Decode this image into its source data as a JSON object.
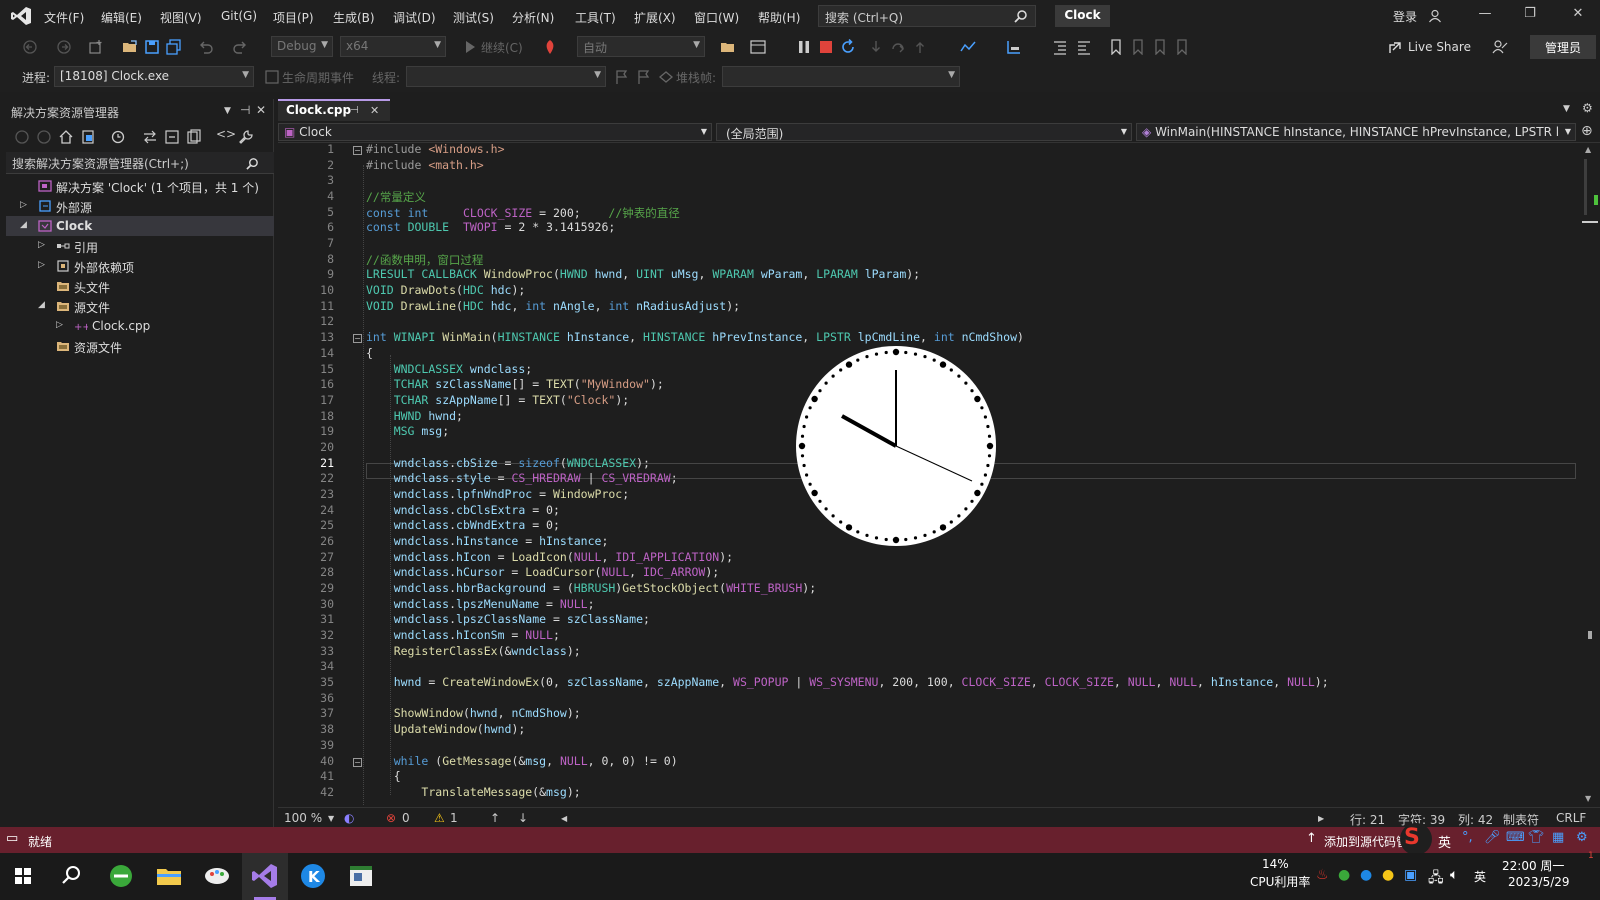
{
  "titlebar": {
    "menu": [
      "文件(F)",
      "编辑(E)",
      "视图(V)",
      "Git(G)",
      "项目(P)",
      "生成(B)",
      "调试(D)",
      "测试(S)",
      "分析(N)",
      "工具(T)",
      "扩展(X)",
      "窗口(W)",
      "帮助(H)"
    ],
    "search_placeholder": "搜索 (Ctrl+Q)",
    "solution_title": "Clock",
    "signin": "登录"
  },
  "toolbar": {
    "config": "Debug",
    "platform": "x64",
    "continue": "继续(C)",
    "auto": "自动",
    "live_share": "Live Share",
    "admin": "管理员",
    "process_label": "进程:",
    "process_value": "[18108] Clock.exe",
    "lifecycle": "生命周期事件",
    "thread_label": "线程:",
    "stackframe_label": "堆栈帧:"
  },
  "solution_explorer": {
    "title": "解决方案资源管理器",
    "search_placeholder": "搜索解决方案资源管理器(Ctrl+;)",
    "items": [
      {
        "label": "解决方案 'Clock' (1 个项目，共 1 个)",
        "level": 0,
        "twisty": "",
        "icon": "solution-icon"
      },
      {
        "label": "外部源",
        "level": 0,
        "twisty": "▷",
        "icon": "external-sources-icon"
      },
      {
        "label": "Clock",
        "level": 0,
        "twisty": "◢",
        "icon": "project-icon",
        "selected": true
      },
      {
        "label": "引用",
        "level": 1,
        "twisty": "▷",
        "icon": "references-icon"
      },
      {
        "label": "外部依赖项",
        "level": 1,
        "twisty": "▷",
        "icon": "dependencies-icon"
      },
      {
        "label": "头文件",
        "level": 1,
        "twisty": "",
        "icon": "filter-folder-icon"
      },
      {
        "label": "源文件",
        "level": 1,
        "twisty": "◢",
        "icon": "filter-folder-icon"
      },
      {
        "label": "Clock.cpp",
        "level": 2,
        "twisty": "▷",
        "icon": "cpp-file-icon"
      },
      {
        "label": "资源文件",
        "level": 1,
        "twisty": "",
        "icon": "filter-folder-icon"
      }
    ]
  },
  "editor": {
    "tab": "Clock.cpp",
    "nav_project": "Clock",
    "nav_scope": "(全局范围)",
    "nav_member": "WinMain(HINSTANCE hInstance, HINSTANCE hPrevInstance, LPSTR l",
    "current_line": 21,
    "lines": [
      {
        "n": "1",
        "t": "#include <Windows.h>"
      },
      {
        "n": "2",
        "t": "#include <math.h>"
      },
      {
        "n": "3",
        "t": ""
      },
      {
        "n": "4",
        "t": "//常量定义"
      },
      {
        "n": "5",
        "t": "const int     CLOCK_SIZE = 200;    //钟表的直径"
      },
      {
        "n": "6",
        "t": "const DOUBLE  TWOPI = 2 * 3.1415926;"
      },
      {
        "n": "7",
        "t": ""
      },
      {
        "n": "8",
        "t": "//函数申明，窗口过程"
      },
      {
        "n": "9",
        "t": "LRESULT CALLBACK WindowProc(HWND hwnd, UINT uMsg, WPARAM wParam, LPARAM lParam);"
      },
      {
        "n": "10",
        "t": "VOID DrawDots(HDC hdc);"
      },
      {
        "n": "11",
        "t": "VOID DrawLine(HDC hdc, int nAngle, int nRadiusAdjust);"
      },
      {
        "n": "12",
        "t": ""
      },
      {
        "n": "13",
        "t": "int WINAPI WinMain(HINSTANCE hInstance, HINSTANCE hPrevInstance, LPSTR lpCmdLine, int nCmdShow)"
      },
      {
        "n": "14",
        "t": "{"
      },
      {
        "n": "15",
        "t": "    WNDCLASSEX wndclass;"
      },
      {
        "n": "16",
        "t": "    TCHAR szClassName[] = TEXT(\"MyWindow\");"
      },
      {
        "n": "17",
        "t": "    TCHAR szAppName[] = TEXT(\"Clock\");"
      },
      {
        "n": "18",
        "t": "    HWND hwnd;"
      },
      {
        "n": "19",
        "t": "    MSG msg;"
      },
      {
        "n": "20",
        "t": ""
      },
      {
        "n": "21",
        "t": "    wndclass.cbSize = sizeof(WNDCLASSEX);"
      },
      {
        "n": "22",
        "t": "    wndclass.style = CS_HREDRAW | CS_VREDRAW;"
      },
      {
        "n": "23",
        "t": "    wndclass.lpfnWndProc = WindowProc;"
      },
      {
        "n": "24",
        "t": "    wndclass.cbClsExtra = 0;"
      },
      {
        "n": "25",
        "t": "    wndclass.cbWndExtra = 0;"
      },
      {
        "n": "26",
        "t": "    wndclass.hInstance = hInstance;"
      },
      {
        "n": "27",
        "t": "    wndclass.hIcon = LoadIcon(NULL, IDI_APPLICATION);"
      },
      {
        "n": "28",
        "t": "    wndclass.hCursor = LoadCursor(NULL, IDC_ARROW);"
      },
      {
        "n": "29",
        "t": "    wndclass.hbrBackground = (HBRUSH)GetStockObject(WHITE_BRUSH);"
      },
      {
        "n": "30",
        "t": "    wndclass.lpszMenuName = NULL;"
      },
      {
        "n": "31",
        "t": "    wndclass.lpszClassName = szClassName;"
      },
      {
        "n": "32",
        "t": "    wndclass.hIconSm = NULL;"
      },
      {
        "n": "33",
        "t": "    RegisterClassEx(&wndclass);"
      },
      {
        "n": "34",
        "t": ""
      },
      {
        "n": "35",
        "t": "    hwnd = CreateWindowEx(0, szClassName, szAppName, WS_POPUP | WS_SYSMENU, 200, 100, CLOCK_SIZE, CLOCK_SIZE, NULL, NULL, hInstance, NULL);"
      },
      {
        "n": "36",
        "t": ""
      },
      {
        "n": "37",
        "t": "    ShowWindow(hwnd, nCmdShow);"
      },
      {
        "n": "38",
        "t": "    UpdateWindow(hwnd);"
      },
      {
        "n": "39",
        "t": ""
      },
      {
        "n": "40",
        "t": "    while (GetMessage(&msg, NULL, 0, 0) != 0)"
      },
      {
        "n": "41",
        "t": "    {"
      },
      {
        "n": "42",
        "t": "        TranslateMessage(&msg);"
      }
    ]
  },
  "editor_status": {
    "zoom": "100 %",
    "errors": "0",
    "warnings": "1",
    "line": "行: 21",
    "char": "字符: 39",
    "col": "列: 42",
    "indent": "制表符",
    "eol": "CRLF"
  },
  "statusbar": {
    "ready": "就绪",
    "add_source_control": "添加到源代码管理",
    "ime": "英"
  },
  "taskbar": {
    "cpu": "14%",
    "cpu_label": "CPU利用率",
    "lang": "英",
    "time": "22:00 周一",
    "date": "2023/5/29",
    "notify_count": "1"
  },
  "colors": {
    "accent": "#b79ae6",
    "status_bar": "#68202d",
    "keyword": "#569cd6",
    "type": "#4ec9b0",
    "comment": "#57a64a",
    "string": "#d69d85",
    "function": "#dcdcaa",
    "macro": "#bd63c5",
    "variable": "#9cdcfe"
  }
}
